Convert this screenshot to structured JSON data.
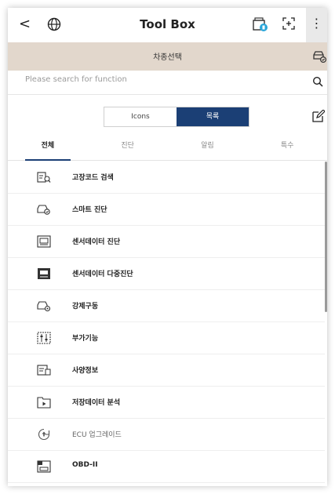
{
  "header": {
    "title": "Tool Box",
    "back_glyph": "<",
    "more_glyph": "⋮",
    "icons": [
      "back-icon",
      "globe-icon",
      "vci-status-icon",
      "scan-icon",
      "more-icon"
    ]
  },
  "vehicle_bar": {
    "label": "차종선택",
    "icon": "vehicle-select-icon"
  },
  "search": {
    "placeholder": "Please search for function",
    "value": "",
    "icon": "search-icon"
  },
  "view_toggle": {
    "options": [
      "Icons",
      "목록"
    ],
    "selected": "목록"
  },
  "tabs": [
    {
      "label": "전체",
      "active": true
    },
    {
      "label": "진단",
      "active": false
    },
    {
      "label": "알림",
      "active": false
    },
    {
      "label": "특수",
      "active": false
    }
  ],
  "functions": [
    {
      "label": "고장코드 검색",
      "icon": "dtc-search-icon",
      "enabled": true
    },
    {
      "label": "스마트 진단",
      "icon": "smart-diagnosis-icon",
      "enabled": true
    },
    {
      "label": "센서데이터 진단",
      "icon": "sensor-data-icon",
      "enabled": true
    },
    {
      "label": "센서데이터 다중진단",
      "icon": "sensor-multi-icon",
      "enabled": true
    },
    {
      "label": "강제구동",
      "icon": "actuation-icon",
      "enabled": true
    },
    {
      "label": "부가기능",
      "icon": "additional-functions-icon",
      "enabled": true
    },
    {
      "label": "사양정보",
      "icon": "specification-icon",
      "enabled": true
    },
    {
      "label": "저장데이터 분석",
      "icon": "saved-data-icon",
      "enabled": true
    },
    {
      "label": "ECU 업그레이드",
      "icon": "ecu-upgrade-icon",
      "enabled": false
    },
    {
      "label": "OBD-II",
      "icon": "obd2-icon",
      "enabled": true
    }
  ],
  "colors": {
    "accent": "#1b3f75",
    "vehicle_bar": "#e2d7cc",
    "vci_badge": "#2aa6d9"
  }
}
